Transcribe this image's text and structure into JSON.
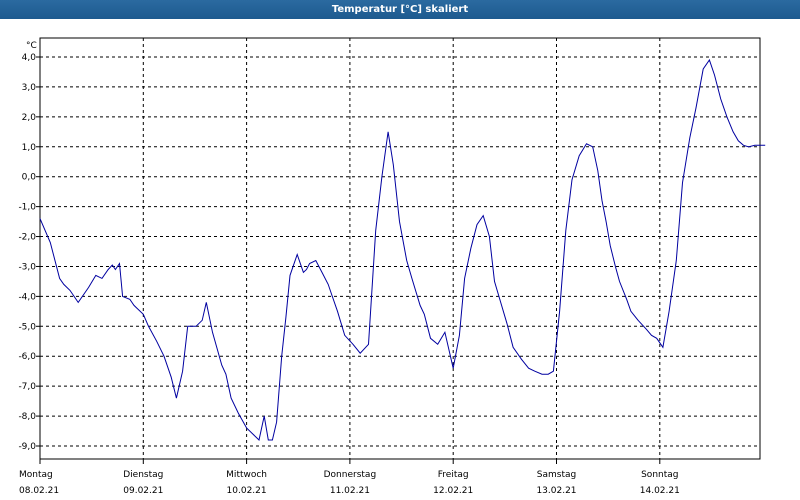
{
  "window": {
    "title": "Temperatur [°C] skaliert"
  },
  "chart_data": {
    "type": "line",
    "title": "Temperatur [°C] skaliert",
    "ylabel": "°C",
    "xlabel": "",
    "ylim": [
      -9.5,
      4.5
    ],
    "xlim": [
      0,
      7.05
    ],
    "y_ticks": [
      "4,0",
      "3,0",
      "2,0",
      "1,0",
      "0,0",
      "-1,0",
      "-2,0",
      "-3,0",
      "-4,0",
      "-5,0",
      "-6,0",
      "-7,0",
      "-8,0",
      "-9,0"
    ],
    "x_ticks": [
      {
        "day": "Montag",
        "date": "08.02.21"
      },
      {
        "day": "Dienstag",
        "date": "09.02.21"
      },
      {
        "day": "Mittwoch",
        "date": "10.02.21"
      },
      {
        "day": "Donnerstag",
        "date": "11.02.21"
      },
      {
        "day": "Freitag",
        "date": "12.02.21"
      },
      {
        "day": "Samstag",
        "date": "13.02.21"
      },
      {
        "day": "Sonntag",
        "date": "14.02.21"
      }
    ],
    "grid": true,
    "line_color": "#0000a0",
    "series": [
      {
        "x": [
          0.0,
          0.1,
          0.19,
          0.23,
          0.29,
          0.37,
          0.39,
          0.47,
          0.54,
          0.6,
          0.66,
          0.7,
          0.73,
          0.77,
          0.8,
          0.87,
          0.91,
          0.94,
          1.0,
          1.05,
          1.13,
          1.2,
          1.27,
          1.32,
          1.38,
          1.43,
          1.51,
          1.57,
          1.61,
          1.67,
          1.76,
          1.8,
          1.85,
          1.92,
          2.0,
          2.06,
          2.12,
          2.17,
          2.21,
          2.25,
          2.29,
          2.34,
          2.38,
          2.42,
          2.49,
          2.55,
          2.58,
          2.61,
          2.67,
          2.73,
          2.79,
          2.83,
          2.88,
          2.95,
          3.03,
          3.1,
          3.18,
          3.25,
          3.31,
          3.37,
          3.42,
          3.48,
          3.55,
          3.6,
          3.68,
          3.72,
          3.78,
          3.85,
          3.92,
          4.0,
          4.06,
          4.11,
          4.17,
          4.23,
          4.29,
          4.35,
          4.4,
          4.46,
          4.52,
          4.58,
          4.66,
          4.73,
          4.79,
          4.86,
          4.92,
          4.97,
          5.03,
          5.09,
          5.15,
          5.22,
          5.29,
          5.35,
          5.4,
          5.44,
          5.48,
          5.52,
          5.57,
          5.61,
          5.68,
          5.72,
          5.79,
          5.87,
          5.92,
          5.97,
          6.03,
          6.09,
          6.16,
          6.22,
          6.29,
          6.35,
          6.42,
          6.48,
          6.53,
          6.59,
          6.65,
          6.71,
          6.76,
          6.81,
          6.86,
          6.92,
          6.97,
          7.02
        ],
        "y": [
          -1.4,
          -2.2,
          -3.4,
          -3.6,
          -3.8,
          -4.2,
          -4.1,
          -3.7,
          -3.3,
          -3.4,
          -3.1,
          -2.95,
          -3.1,
          -2.9,
          -4.0,
          -4.1,
          -4.3,
          -4.4,
          -4.6,
          -5.0,
          -5.5,
          -6.0,
          -6.7,
          -7.4,
          -6.5,
          -5.0,
          -5.0,
          -4.8,
          -4.2,
          -5.2,
          -6.3,
          -6.6,
          -7.4,
          -7.9,
          -8.4,
          -8.6,
          -8.8,
          -8.0,
          -8.8,
          -8.8,
          -8.2,
          -6.0,
          -4.7,
          -3.3,
          -2.6,
          -3.2,
          -3.1,
          -2.9,
          -2.8,
          -3.2,
          -3.6,
          -4.0,
          -4.5,
          -5.3,
          -5.6,
          -5.9,
          -5.6,
          -1.8,
          0.0,
          1.5,
          0.4,
          -1.5,
          -2.8,
          -3.4,
          -4.3,
          -4.6,
          -5.4,
          -5.6,
          -5.2,
          -6.4,
          -5.3,
          -3.4,
          -2.4,
          -1.6,
          -1.3,
          -2.0,
          -3.5,
          -4.2,
          -4.9,
          -5.7,
          -6.1,
          -6.4,
          -6.5,
          -6.6,
          -6.6,
          -6.5,
          -4.5,
          -1.8,
          -0.1,
          0.7,
          1.1,
          1.0,
          0.2,
          -0.8,
          -1.5,
          -2.3,
          -3.0,
          -3.5,
          -4.1,
          -4.5,
          -4.8,
          -5.1,
          -5.3,
          -5.4,
          -5.7,
          -4.5,
          -2.8,
          -0.2,
          1.3,
          2.3,
          3.6,
          3.9,
          3.4,
          2.6,
          2.0,
          1.5,
          1.2,
          1.05,
          1.0,
          1.05,
          1.05,
          1.05
        ]
      }
    ]
  }
}
